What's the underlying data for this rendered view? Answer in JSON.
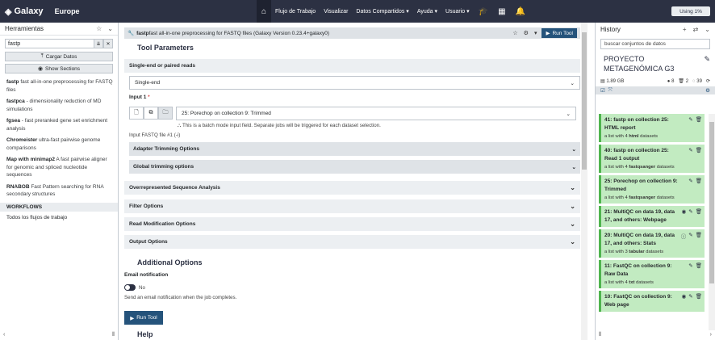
{
  "masthead": {
    "brand": "Galaxy",
    "subsite": "Europe",
    "nav": [
      "Flujo de Trabajo",
      "Visualizar",
      "Datos Compartidos",
      "Ayuda",
      "Usuario"
    ],
    "quota": "Using 1%",
    "colors": {
      "bar": "#2c3143"
    }
  },
  "tools": {
    "header": "Herramientas",
    "search_value": "fastp",
    "upload_label": "Cargar Datos",
    "show_sections_label": "Show Sections",
    "items": [
      {
        "name": "fastp",
        "desc": " fast all-in-one preprocessing for FASTQ files"
      },
      {
        "name": "fastpca",
        "desc": " - dimensionality reduction of MD simulations"
      },
      {
        "name": "fgsea",
        "desc": " - fast preranked gene set enrichment analysis"
      },
      {
        "name": "Chromeister",
        "desc": " ultra-fast pairwise genome comparisons"
      },
      {
        "name": "Map with minimap2",
        "desc": " A fast pairwise aligner for genomic and spliced nucleotide sequences"
      },
      {
        "name": "RNABOB",
        "desc": " Fast Pattern searching for RNA secondary structures"
      }
    ],
    "workflows_label": "WORKFLOWS",
    "all_workflows_label": "Todos los flujos de trabajo"
  },
  "form": {
    "tool_name": "fastp",
    "tool_desc": " fast all-in-one preprocessing for FASTQ files (Galaxy Version 0.23.4+galaxy0)",
    "run_label": "Run Tool",
    "params_title": "Tool Parameters",
    "single_paired_label": "Single-end or paired reads",
    "single_paired_value": "Single-end",
    "input1_label": "Input 1",
    "input1_req": "*",
    "input1_value": "25: Porechop on collection 9: Trimmed",
    "batch_hint": "This is a batch mode input field. Separate jobs will be triggered for each dataset selection.",
    "input_help": "Input FASTQ file #1 (-i)",
    "sections": {
      "adapter": "Adapter Trimming Options",
      "global": "Global trimming options",
      "overrep": "Overrepresented Sequence Analysis",
      "filter": "Filter Options",
      "readmod": "Read Modification Options",
      "output": "Output Options"
    },
    "additional_title": "Additional Options",
    "email_label": "Email notification",
    "email_toggle_value": "No",
    "email_help": "Send an email notification when the job completes.",
    "help_title": "Help"
  },
  "history": {
    "header": "History",
    "search_placeholder": "buscar conjuntos de datos",
    "name": "PROYECTO METAGENÓMICA G3",
    "size": "1.89 GB",
    "count_ok": "8",
    "count_deleted": "2",
    "count_hidden": "39",
    "datasets": [
      {
        "title": "41: fastp on collection 25: HTML report",
        "sub_pre": "a list with 4 ",
        "sub_bold": "html",
        "sub_post": " datasets"
      },
      {
        "title": "40: fastp on collection 25: Read 1 output",
        "sub_pre": "a list with 4 ",
        "sub_bold": "fastqsanger",
        "sub_post": " datasets"
      },
      {
        "title": "25: Porechop on collection 9: Trimmed",
        "sub_pre": "a list with 4 ",
        "sub_bold": "fastqsanger",
        "sub_post": " datasets"
      },
      {
        "title": "21: MultiQC on data 19, data 17, and others: Webpage",
        "sub_pre": "",
        "sub_bold": "",
        "sub_post": ""
      },
      {
        "title": "20: MultiQC on data 19, data 17, and others: Stats",
        "sub_pre": "a list with 3 ",
        "sub_bold": "tabular",
        "sub_post": " datasets"
      },
      {
        "title": "11: FastQC on collection 9: Raw Data",
        "sub_pre": "a list with 4 ",
        "sub_bold": "txt",
        "sub_post": " datasets"
      },
      {
        "title": "10: FastQC on collection 9: Web page",
        "sub_pre": "",
        "sub_bold": "",
        "sub_post": ""
      }
    ]
  }
}
